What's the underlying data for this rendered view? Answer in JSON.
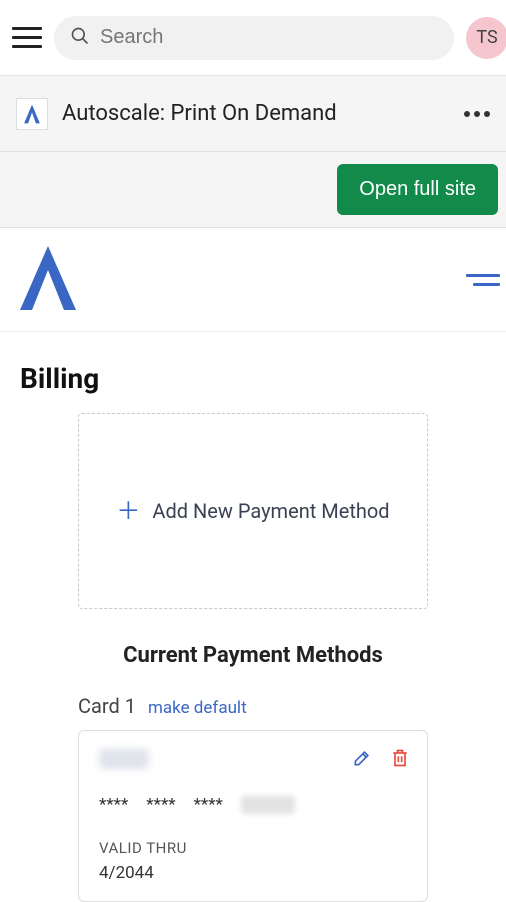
{
  "topbar": {
    "search_placeholder": "Search",
    "avatar_initials": "TS"
  },
  "app": {
    "name": "Autoscale: Print On Demand"
  },
  "fullsite": {
    "button_label": "Open full site"
  },
  "page": {
    "title": "Billing"
  },
  "addcard": {
    "label": "Add New Payment Method"
  },
  "section": {
    "heading": "Current Payment Methods"
  },
  "cards": [
    {
      "label": "Card 1",
      "make_default_label": "make default",
      "masked_groups": [
        "****",
        "****",
        "****"
      ],
      "valid_thru_label": "VALID THRU",
      "expiry": "4/2044"
    }
  ],
  "colors": {
    "accent_blue": "#3a66c4",
    "accent_green": "#128a4a",
    "danger_red": "#e74c3c"
  }
}
